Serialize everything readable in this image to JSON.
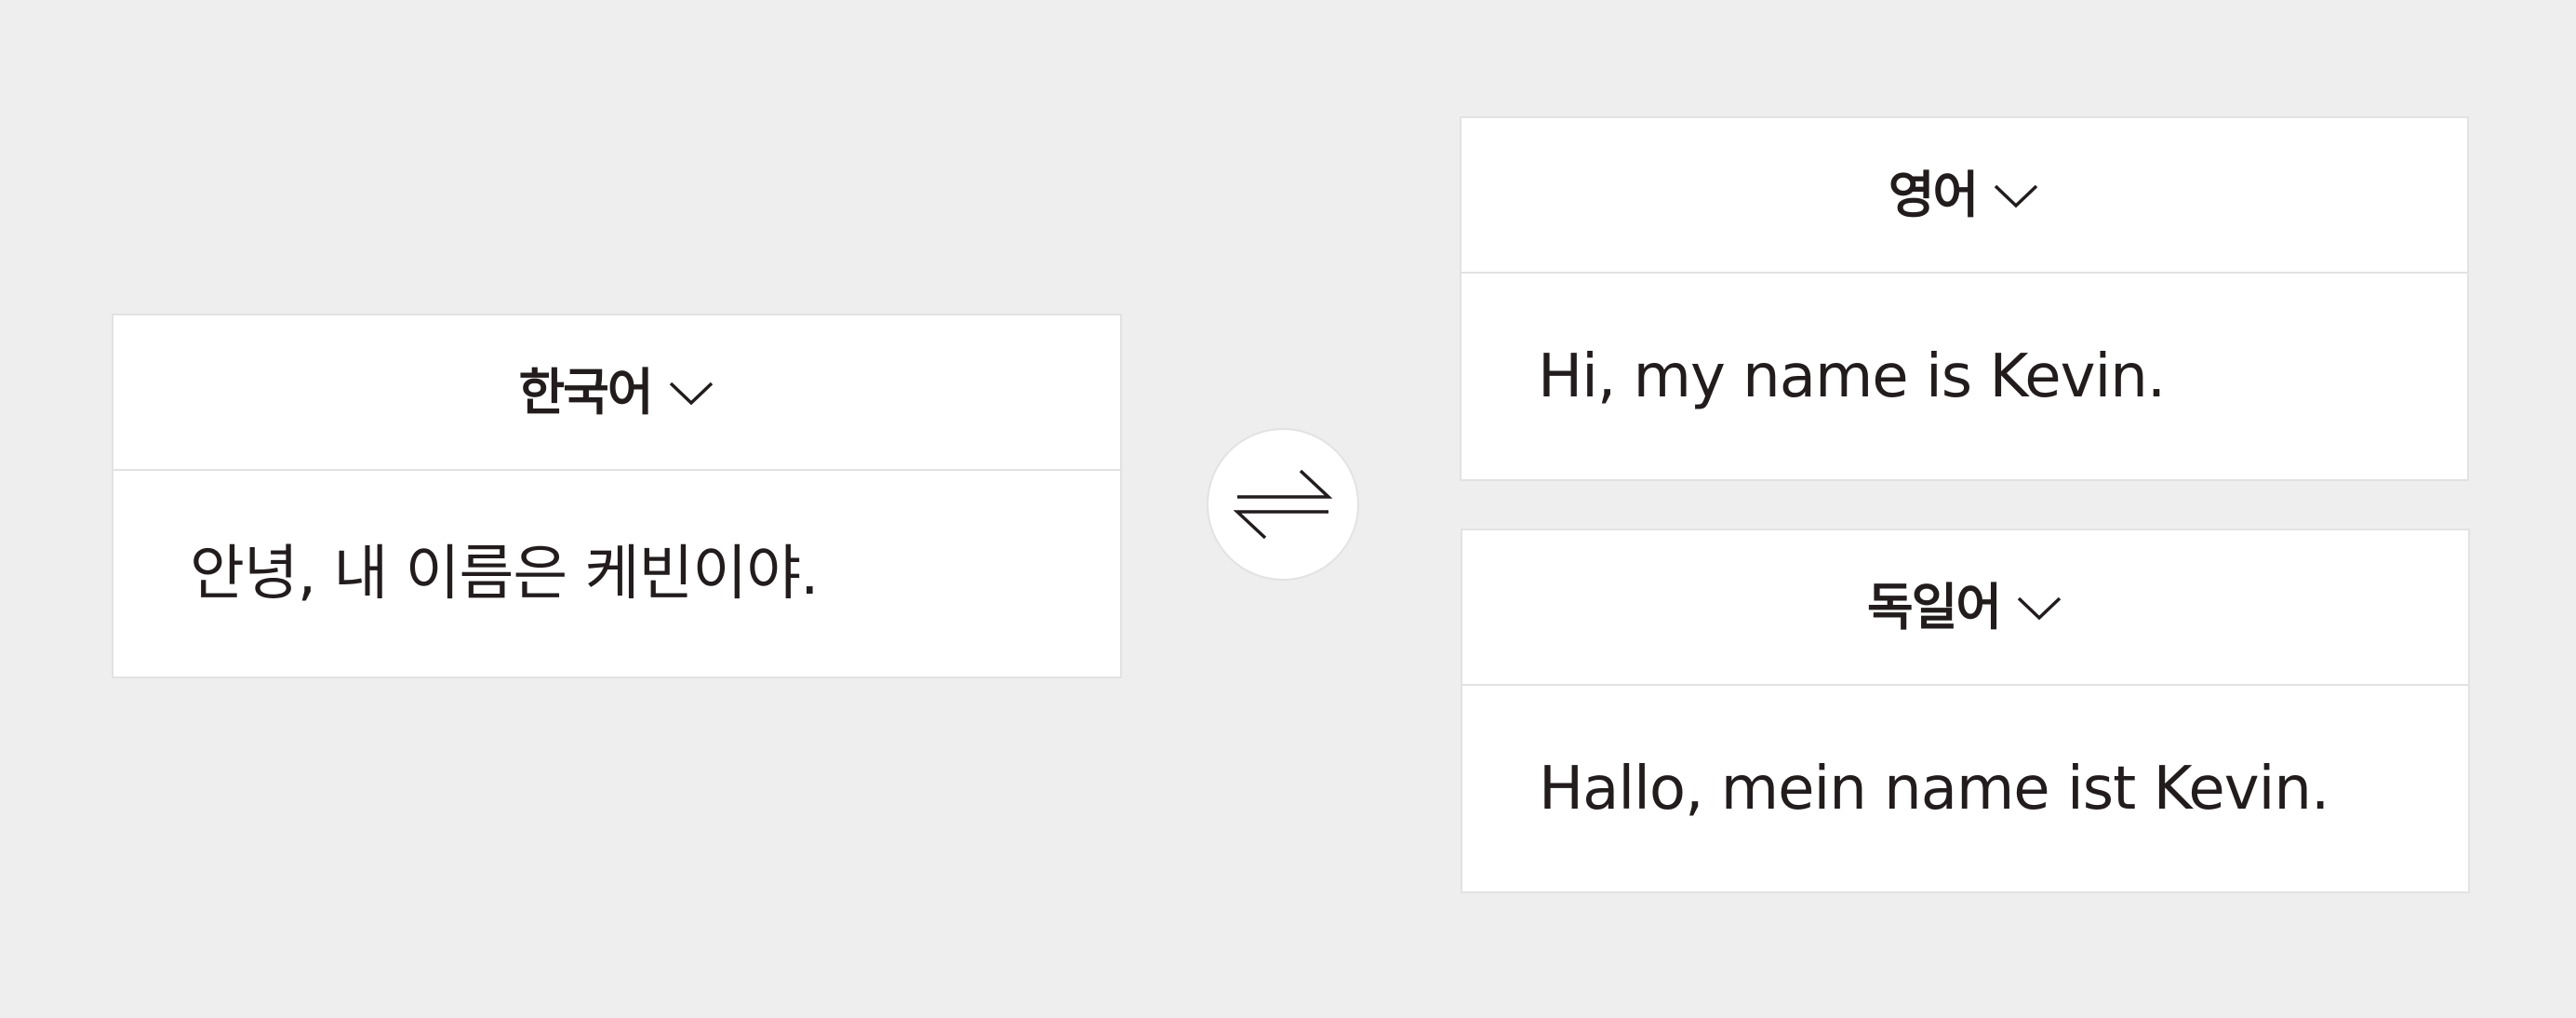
{
  "source": {
    "language": "한국어",
    "text": "안녕, 내 이름은 케빈이야."
  },
  "swap": {
    "icon": "swap-arrows-icon"
  },
  "targets": [
    {
      "language": "영어",
      "text": "Hi, my name is Kevin."
    },
    {
      "language": "독일어",
      "text": "Hallo, mein name ist Kevin."
    }
  ],
  "icons": {
    "dropdown": "chevron-down-icon"
  },
  "colors": {
    "background": "#eeeeee",
    "panel": "#ffffff",
    "border": "#e2e2e2",
    "text": "#221c1d"
  }
}
